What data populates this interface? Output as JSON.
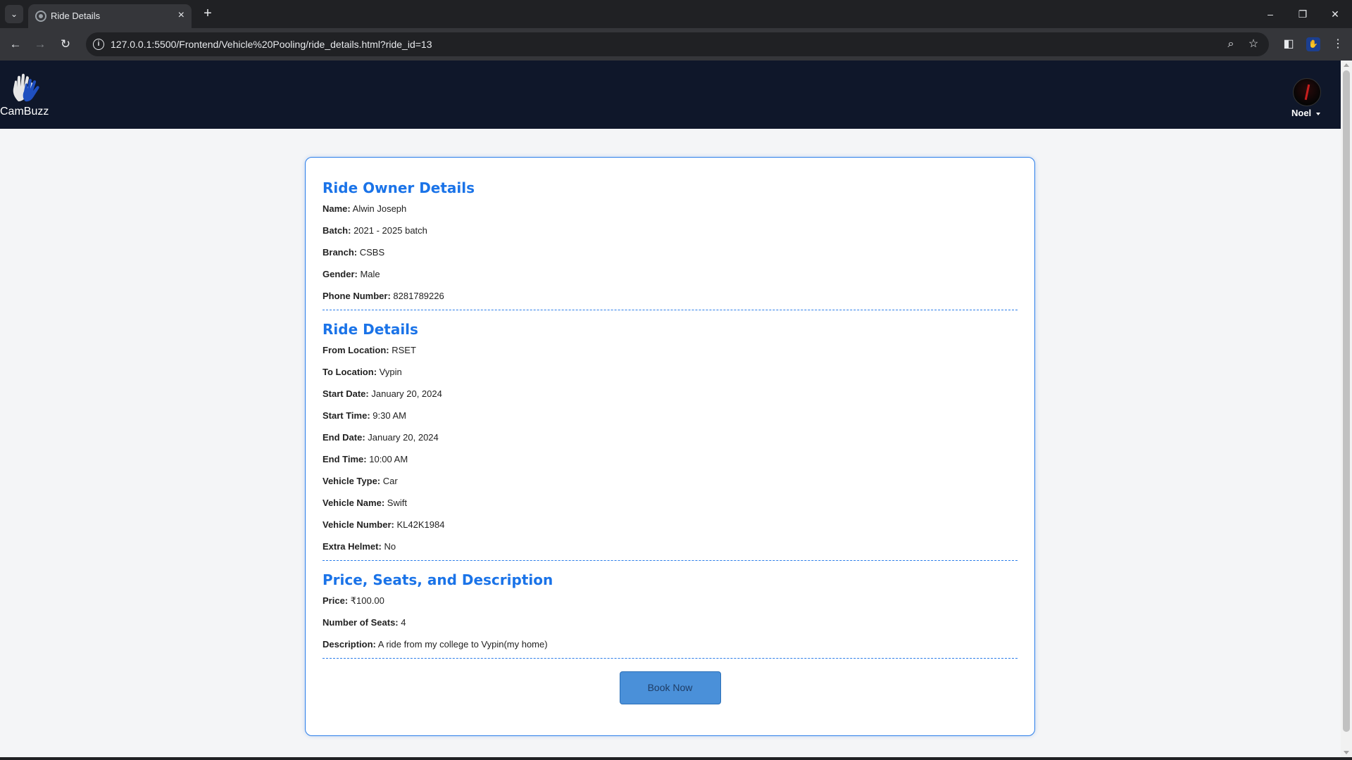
{
  "browser": {
    "tab_title": "Ride Details",
    "url": "127.0.0.1:5500/Frontend/Vehicle%20Pooling/ride_details.html?ride_id=13"
  },
  "header": {
    "brand": "CamBuzz",
    "user_name": "Noel"
  },
  "owner": {
    "title": "Ride Owner Details",
    "fields": [
      {
        "label": "Name:",
        "value": "Alwin Joseph"
      },
      {
        "label": "Batch:",
        "value": "2021 - 2025 batch"
      },
      {
        "label": "Branch:",
        "value": "CSBS"
      },
      {
        "label": "Gender:",
        "value": "Male"
      },
      {
        "label": "Phone Number:",
        "value": "8281789226"
      }
    ]
  },
  "ride": {
    "title": "Ride Details",
    "fields": [
      {
        "label": "From Location:",
        "value": "RSET"
      },
      {
        "label": "To Location:",
        "value": "Vypin"
      },
      {
        "label": "Start Date:",
        "value": "January 20, 2024"
      },
      {
        "label": "Start Time:",
        "value": "9:30 AM"
      },
      {
        "label": "End Date:",
        "value": "January 20, 2024"
      },
      {
        "label": "End Time:",
        "value": "10:00 AM"
      },
      {
        "label": "Vehicle Type:",
        "value": "Car"
      },
      {
        "label": "Vehicle Name:",
        "value": "Swift"
      },
      {
        "label": "Vehicle Number:",
        "value": "KL42K1984"
      },
      {
        "label": "Extra Helmet:",
        "value": "No"
      }
    ]
  },
  "pricing": {
    "title": "Price, Seats, and Description",
    "fields": [
      {
        "label": "Price:",
        "value": "₹100.00"
      },
      {
        "label": "Number of Seats:",
        "value": "4"
      },
      {
        "label": "Description:",
        "value": "A ride from my college to Vypin(my home)"
      }
    ]
  },
  "book_label": "Book Now",
  "colors": {
    "accent": "#1a73e8",
    "header_bg": "#0f172a",
    "button": "#4a90d9"
  }
}
